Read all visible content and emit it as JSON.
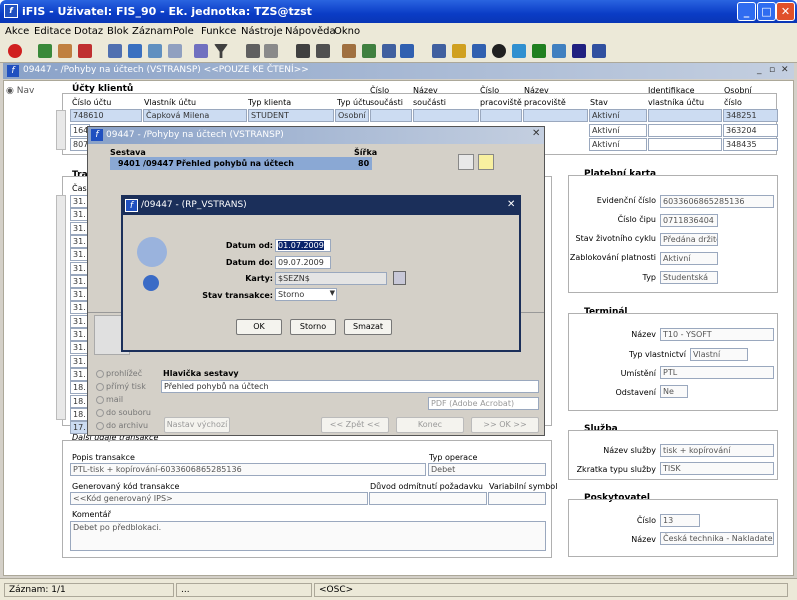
{
  "app": {
    "title": "iFIS - Uživatel: FIS_90 - Ek. jednotka: TZS@tzst"
  },
  "menu": [
    "Akce",
    "Editace",
    "Dotaz",
    "Blok",
    "Záznam",
    "Pole",
    "Funkce",
    "Nástroje",
    "Nápověda",
    "Okno"
  ],
  "toolbar_icons": [
    "exit-icon",
    "save-icon",
    "print-icon",
    "cut-icon",
    "copy-icon",
    "paste-icon",
    "search-icon",
    "filter-icon",
    "help-icon"
  ],
  "window": {
    "title": "09447 - /Pohyby na účtech (VSTRANSP) <<POUZE KE ČTENÍ>>"
  },
  "nav": "Nav",
  "ucty": {
    "title": "Účty klientů",
    "headers": {
      "cislo_uctu": "Číslo účtu",
      "vlastnik": "Vlastník účtu",
      "typ_klienta": "Typ klienta",
      "typ_uctu": "Typ účtu",
      "cislo_soucasti": "Číslo součásti",
      "cislo": "Číslo",
      "soucasti": "součásti",
      "nazev_soucasti": "Název",
      "nazev2": "součásti",
      "cislo_prac": "Číslo",
      "prac": "pracoviště",
      "nazev_prac": "Název",
      "nazev_prac2": "pracoviště",
      "stav": "Stav",
      "ident": "Identifikace",
      "ident2": "vlastníka účtu",
      "osobni": "Osobní",
      "osobni2": "číslo"
    },
    "row1": {
      "cislo": "748610",
      "vlastnik": "Čapková Milena",
      "typ": "STUDENT",
      "typ_uctu": "Osobní",
      "stav": "Aktivní",
      "osobni": "348251"
    },
    "row2": {
      "cislo": "164",
      "stav": "Aktivní",
      "osobni": "363204"
    },
    "row3": {
      "cislo": "807",
      "stav": "Aktivní",
      "osobni": "348435"
    }
  },
  "tran": {
    "title": "Tra",
    "cas": "Čas",
    "rows": [
      "31.",
      "31.",
      "31.",
      "31.",
      "31.",
      "31.",
      "31.",
      "31.",
      "31.",
      "31.",
      "31.",
      "31.",
      "31.",
      "31.",
      "18.",
      "18.",
      "18.",
      "17."
    ]
  },
  "detail": {
    "dalsi": "Další údaje transakce",
    "popis_label": "Popis transakce",
    "popis": "PTL-tisk + kopírování-6033606865285136",
    "typ_op_label": "Typ operace",
    "typ_op": "Debet",
    "gen_label": "Generovaný kód transakce",
    "gen": "<<Kód generovaný IPS>",
    "duvod_label": "Důvod odmítnutí požadavku",
    "var_label": "Variabilní symbol",
    "koment_label": "Komentář",
    "koment": "Debet po předblokaci."
  },
  "karta": {
    "title": "Platební karta",
    "evid_label": "Evidenční číslo",
    "evid": "6033606865285136",
    "cip_label": "Číslo čipu",
    "cip": "0711836404",
    "stav_label": "Stav životního cyklu",
    "stav": "Předána držiteli",
    "zablok_label": "Zablokování platnosti",
    "zablok": "Aktivní",
    "typ_label": "Typ",
    "typ": "Studentská"
  },
  "terminal": {
    "title": "Terminál",
    "nazev_label": "Název",
    "nazev": "T10 - YSOFT",
    "vlast_label": "Typ vlastnictví",
    "vlast": "Vlastní",
    "umist_label": "Umístění",
    "umist": "PTL",
    "odst_label": "Odstavení",
    "odst": "Ne"
  },
  "sluzba": {
    "title": "Služba",
    "nazev_label": "Název služby",
    "nazev": "tisk + kopírování",
    "zkr_label": "Zkratka typu služby",
    "zkr": "TISK"
  },
  "posk": {
    "title": "Poskytovatel",
    "cislo_label": "Číslo",
    "cislo": "13",
    "nazev_label": "Název",
    "nazev": "Česká technika - Nakladatelství"
  },
  "report_dlg": {
    "title": "09447 - /Pohyby na účtech (VSTRANSP)",
    "sestava_label": "Sestava",
    "sirka_label": "Šířka",
    "sestava_code": "9401 /09447",
    "sestava_name": "Přehled pohybů na účtech",
    "sirka": "80",
    "output": [
      "prohlížeč",
      "přímý tisk",
      "mail",
      "do souboru",
      "do archivu"
    ],
    "hlav_label": "Hlavička sestavy",
    "hlav": "Přehled pohybů na účtech",
    "format": "PDF (Adobe Acrobat)",
    "nastav": "Nastav výchozí",
    "zpet": "<< Zpět <<",
    "konec": "Konec",
    "ok": ">> OK >>"
  },
  "param_dlg": {
    "title": "/09447 - (RP_VSTRANS)",
    "od_label": "Datum od:",
    "od": "01.07.2009",
    "do_label": "Datum do:",
    "do": "09.07.2009",
    "karty_label": "Karty:",
    "karty": "$SEZN$",
    "stav_label": "Stav transakce:",
    "stav": "Storno",
    "ok": "OK",
    "storno": "Storno",
    "smazat": "Smazat"
  },
  "status": {
    "zaznam": "Záznam: 1/1",
    "dots": "...",
    "osc": "<OSC>"
  }
}
